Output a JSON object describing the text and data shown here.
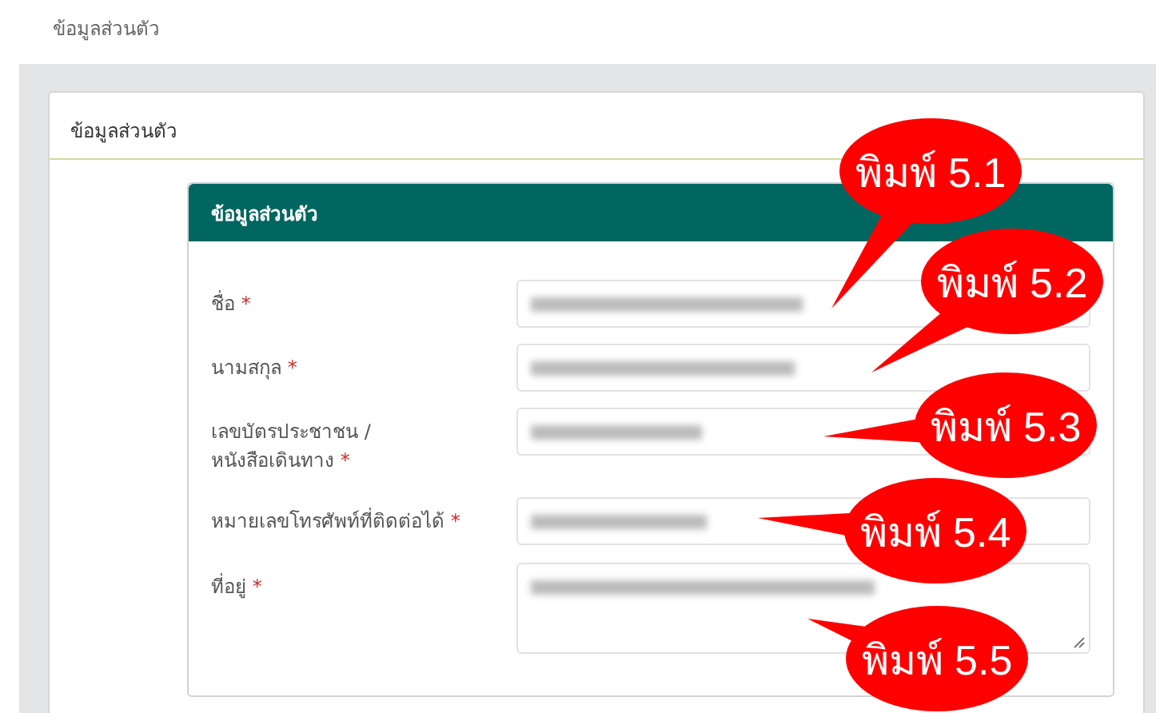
{
  "breadcrumb": "ข้อมูลส่วนตัว",
  "card_title": "ข้อมูลส่วนตัว",
  "panel_title": "ข้อมูลส่วนตัว",
  "fields": [
    {
      "label": "ชื่อ",
      "required_mark": "*",
      "kind": "input",
      "redacted": true
    },
    {
      "label": "นามสกุล",
      "required_mark": "*",
      "kind": "input",
      "redacted": true
    },
    {
      "label": "เลขบัตรประชาชน / หนังสือเดินทาง",
      "required_mark": "*",
      "kind": "input",
      "redacted": true
    },
    {
      "label": "หมายเลขโทรศัพท์ที่ติดต่อได้",
      "required_mark": "*",
      "kind": "input",
      "redacted": true
    },
    {
      "label": "ที่อยู่",
      "required_mark": "*",
      "kind": "textarea",
      "redacted": true
    }
  ],
  "callouts": [
    {
      "text": "พิมพ์ 5.1"
    },
    {
      "text": "พิมพ์ 5.2"
    },
    {
      "text": "พิมพ์ 5.3"
    },
    {
      "text": "พิมพ์ 5.4"
    },
    {
      "text": "พิมพ์ 5.5"
    }
  ]
}
